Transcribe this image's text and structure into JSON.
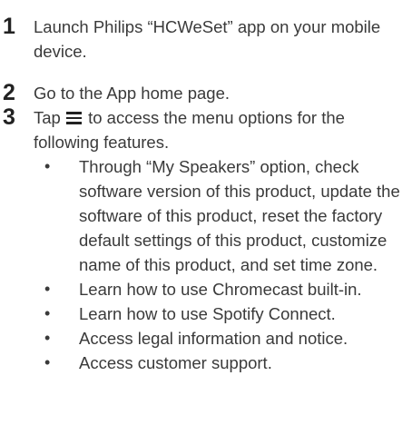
{
  "steps": [
    {
      "number": "1",
      "text": "Launch Philips “HCWeSet” app on your mobile device."
    },
    {
      "number": "2",
      "text": "Go to the App home page."
    },
    {
      "number": "3",
      "text_before_icon": "Tap",
      "icon": "hamburger-menu-icon",
      "text_after_icon": "to access the menu options for the following features."
    }
  ],
  "features": [
    "Through “My Speakers” option, check software version of this product, update the software of this product, reset the factory default settings of this product, customize name of this product, and set time zone.",
    "Learn how to use Chromecast built-in.",
    "Learn how to use Spotify Connect.",
    "Access legal information and notice.",
    "Access customer support."
  ],
  "bullet_symbol": "•"
}
